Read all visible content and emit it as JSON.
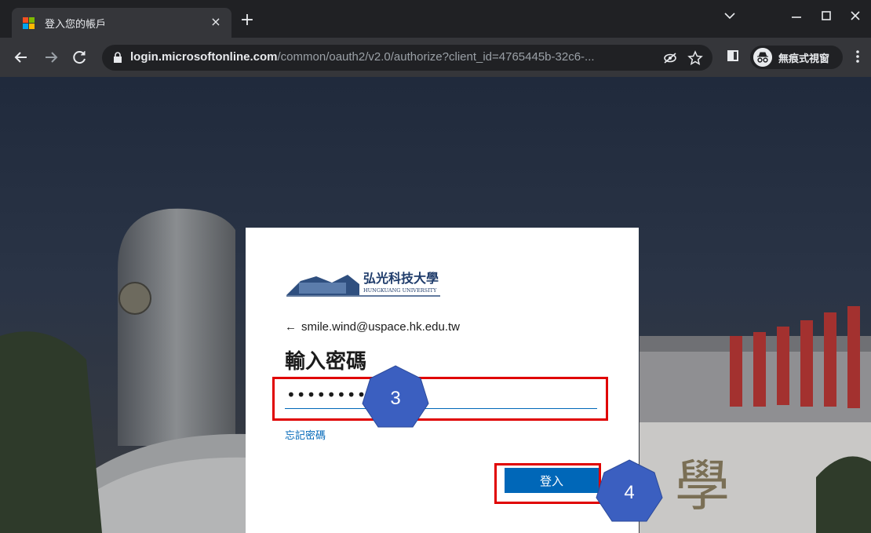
{
  "browser": {
    "tab_title": "登入您的帳戶",
    "close_tab_glyph": "×",
    "new_tab_glyph": "+",
    "url_host": "login.microsoftonline.com",
    "url_path": "/common/oauth2/v2.0/authorize?client_id=4765445b-32c6-...",
    "incognito_label": "無痕式視窗",
    "icons": [
      "back-icon",
      "forward-icon",
      "reload-icon",
      "lock-icon",
      "eye-slash-icon",
      "star-icon",
      "side-panel-icon",
      "incognito-icon",
      "kebab-menu-icon",
      "minimize-icon",
      "maximize-icon",
      "close-window-icon",
      "chevron-down-icon"
    ]
  },
  "login": {
    "org_name": "弘光科技大學",
    "org_name_en": "HUNGKUANG UNIVERSITY",
    "back_arrow": "←",
    "account_email": "smile.wind@uspace.hk.edu.tw",
    "heading": "輸入密碼",
    "password_value": "•••••••••",
    "forgot_link": "忘記密碼",
    "signin_button": "登入"
  },
  "annotations": {
    "step3_label": "3",
    "step4_label": "4",
    "highlight_color": "#e00000",
    "marker_color": "#3b5fc0"
  },
  "colors": {
    "accent": "#0067b8",
    "chrome_dark": "#202124",
    "chrome_toolbar": "#35363a"
  }
}
